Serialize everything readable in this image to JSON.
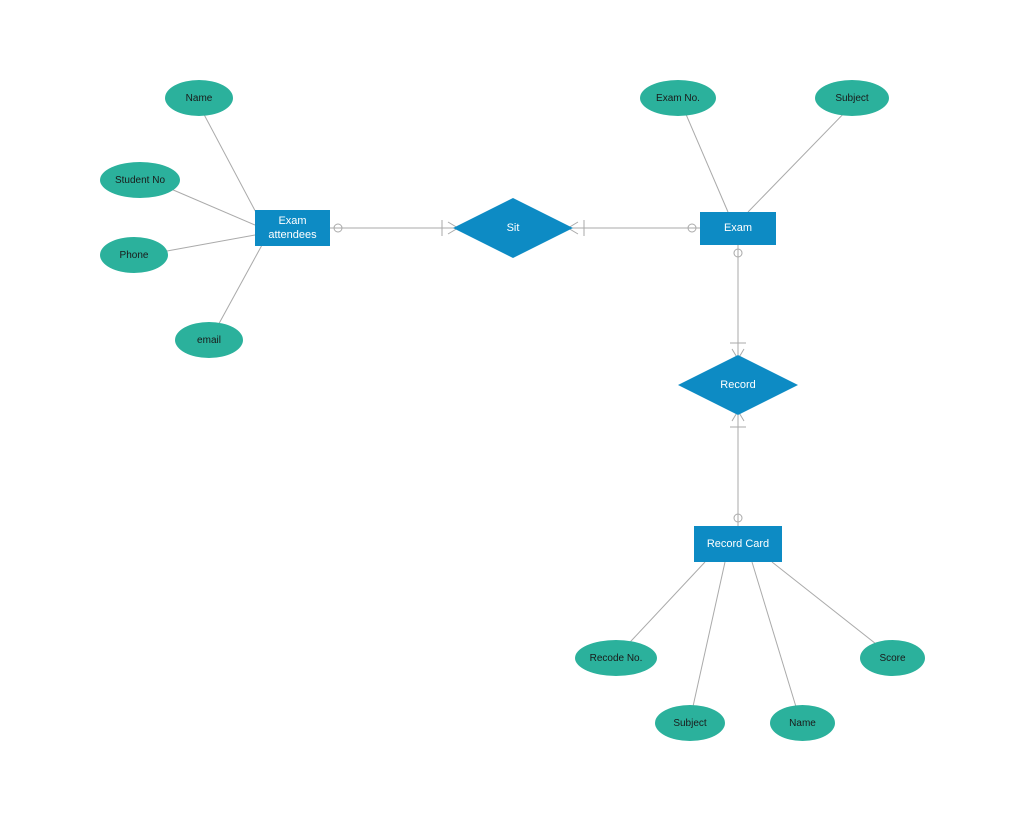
{
  "entities": {
    "exam_attendees": "Exam attendees",
    "exam": "Exam",
    "record_card": "Record Card"
  },
  "relationships": {
    "sit": "Sit",
    "record": "Record"
  },
  "attributes": {
    "exam_attendees": {
      "name": "Name",
      "student_no": "Student No",
      "phone": "Phone",
      "email": "email"
    },
    "exam": {
      "exam_no": "Exam No.",
      "subject": "Subject"
    },
    "record_card": {
      "recode_no": "Recode No.",
      "subject": "Subject",
      "name": "Name",
      "score": "Score"
    }
  },
  "colors": {
    "entity_fill": "#0d8bc4",
    "attribute_fill": "#2bb19c",
    "connector": "#aaaaaa"
  }
}
